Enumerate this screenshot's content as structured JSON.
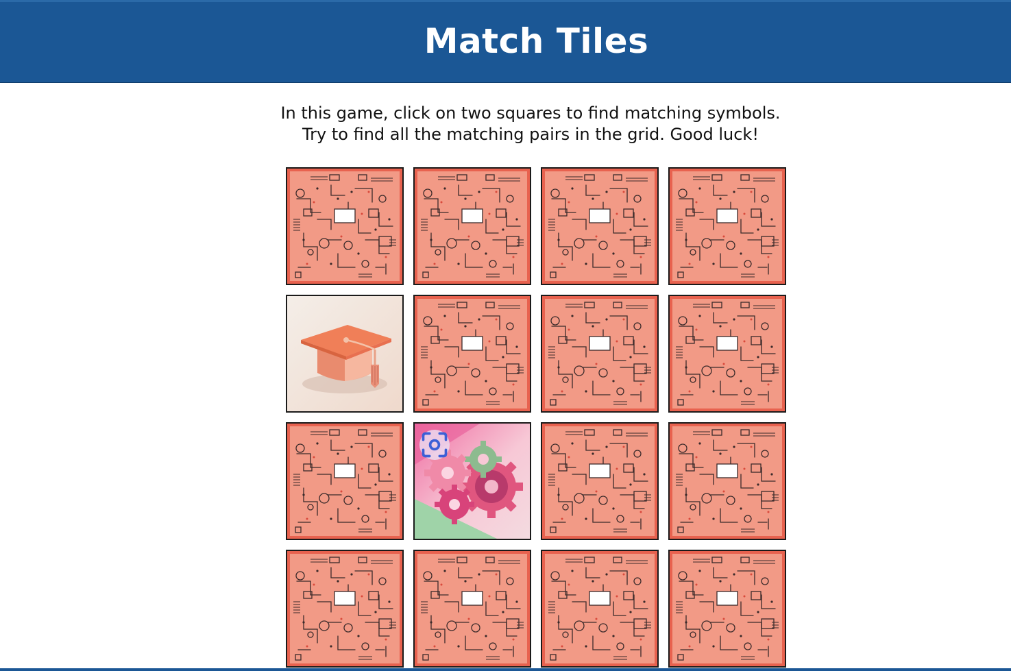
{
  "header": {
    "title": "Match Tiles"
  },
  "instructions": {
    "line1": "In this game, click on two squares to find matching symbols.",
    "line2": "Try to find all the matching pairs in the grid. Good luck!"
  },
  "colors": {
    "header_bg": "#1b5795",
    "tile_back": "#e8624f",
    "tile_border": "#1a1a1a"
  },
  "tiles": [
    {
      "state": "hidden",
      "symbol": "circuit-pattern-back"
    },
    {
      "state": "hidden",
      "symbol": "circuit-pattern-back"
    },
    {
      "state": "hidden",
      "symbol": "circuit-pattern-back"
    },
    {
      "state": "hidden",
      "symbol": "circuit-pattern-back"
    },
    {
      "state": "revealed",
      "symbol": "graduation-cap"
    },
    {
      "state": "hidden",
      "symbol": "circuit-pattern-back"
    },
    {
      "state": "hidden",
      "symbol": "circuit-pattern-back"
    },
    {
      "state": "hidden",
      "symbol": "circuit-pattern-back"
    },
    {
      "state": "hidden",
      "symbol": "circuit-pattern-back"
    },
    {
      "state": "revealed",
      "symbol": "gears"
    },
    {
      "state": "hidden",
      "symbol": "circuit-pattern-back"
    },
    {
      "state": "hidden",
      "symbol": "circuit-pattern-back"
    },
    {
      "state": "hidden",
      "symbol": "circuit-pattern-back"
    },
    {
      "state": "hidden",
      "symbol": "circuit-pattern-back"
    },
    {
      "state": "hidden",
      "symbol": "circuit-pattern-back"
    },
    {
      "state": "hidden",
      "symbol": "circuit-pattern-back"
    }
  ],
  "visual_search_button": {
    "icon": "visual-search-icon"
  }
}
